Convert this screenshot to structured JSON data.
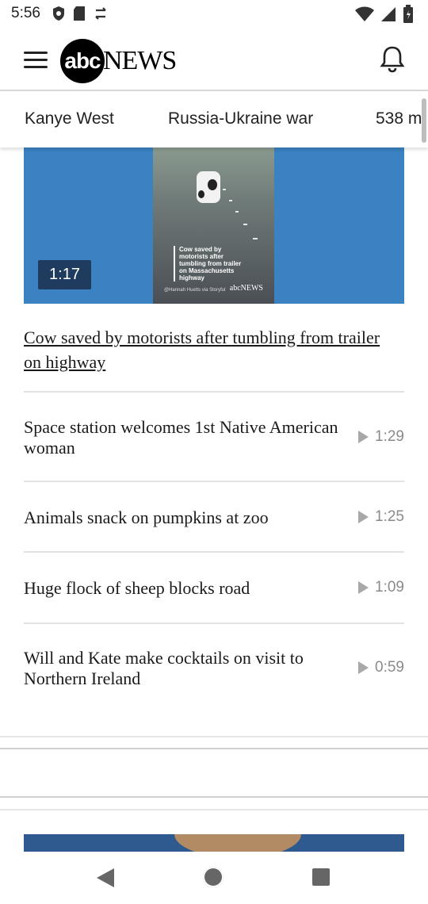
{
  "status_bar": {
    "time": "5:56",
    "left_icons": [
      "shield-icon",
      "sd-card-icon",
      "sync-icon"
    ],
    "right_icons": [
      "wifi-icon",
      "cell-signal-icon",
      "battery-icon"
    ]
  },
  "header": {
    "logo_abc": "abc",
    "logo_news": "NEWS",
    "menu_icon": "hamburger-menu-icon",
    "bell_icon": "bell-icon"
  },
  "tabs": [
    {
      "label": "Kanye West"
    },
    {
      "label": "Russia-Ukraine war"
    },
    {
      "label": "538 m"
    }
  ],
  "feature": {
    "duration": "1:17",
    "thumb_caption": "Cow saved by motorists after tumbling from trailer on Massachusetts highway",
    "thumb_logo": "abcNEWS",
    "thumb_credit": "@Hannah Huetts via Storyful",
    "headline": "Cow saved by motorists after tumbling from trailer on highway"
  },
  "videos": [
    {
      "title": "Space station welcomes 1st Native American woman",
      "duration": "1:29"
    },
    {
      "title": "Animals snack on pumpkins at zoo",
      "duration": "1:25"
    },
    {
      "title": "Huge flock of sheep blocks road",
      "duration": "1:09"
    },
    {
      "title": "Will and Kate make cocktails on visit to Northern Ireland",
      "duration": "0:59"
    }
  ],
  "colors": {
    "accent_blue": "#3a82c2",
    "badge_bg": "#1f3c5e",
    "meta_gray": "#8a8a8a"
  }
}
